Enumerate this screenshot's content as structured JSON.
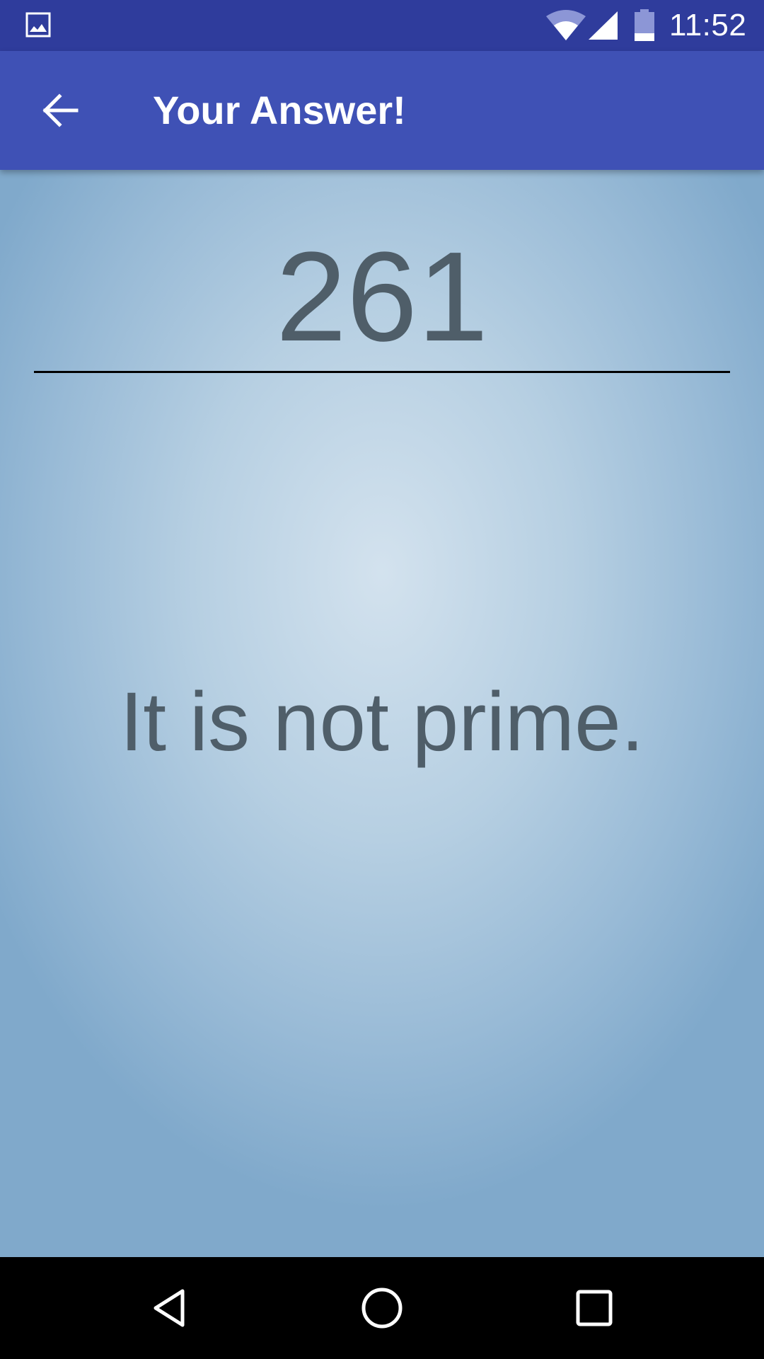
{
  "status_bar": {
    "time": "11:52",
    "icons": [
      "gallery-icon",
      "wifi-icon",
      "signal-icon",
      "battery-icon"
    ]
  },
  "app_bar": {
    "title": "Your Answer!",
    "back_icon": "arrow-back-icon"
  },
  "main": {
    "number": "261",
    "message": "It is not prime."
  },
  "nav_bar": {
    "icons": [
      "back-triangle-icon",
      "home-circle-icon",
      "recents-square-icon"
    ]
  },
  "colors": {
    "status_bar": "#2f3c9c",
    "app_bar": "#3f51b5",
    "text": "#4f5e69",
    "background_center": "#d3e2ee",
    "background_edge": "#80a9cb"
  }
}
